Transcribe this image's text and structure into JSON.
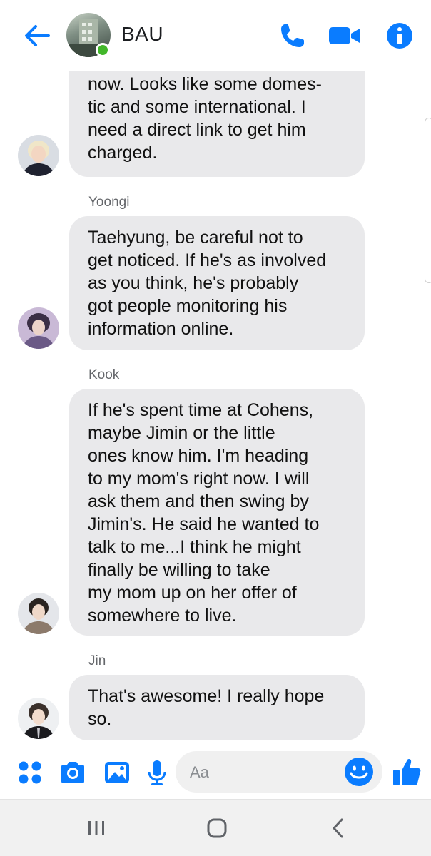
{
  "header": {
    "title": "BAU",
    "online": true,
    "icons": [
      "back-arrow-icon",
      "phone-icon",
      "video-icon",
      "info-icon"
    ],
    "accent_color": "#0a7cff"
  },
  "messages": [
    {
      "sender": "",
      "text": "I'm tracking that down right\nnow. Looks like some domes-\ntic and some international. I\nneed a direct link to get him\ncharged.",
      "avatar": "avatar-blond"
    },
    {
      "sender": "Yoongi",
      "text": "Taehyung, be careful not to\nget noticed. If he's as involved\nas you think, he's probably\ngot people monitoring his\ninformation online.",
      "avatar": "avatar-yoongi"
    },
    {
      "sender": "Kook",
      "text": "If he's spent time at Cohens,\nmaybe Jimin or the little\nones know him. I'm heading\nto my mom's right now. I will\nask them and then swing by\nJimin's. He said he wanted to\ntalk to me...I think he might\nfinally be willing to take\nmy mom up on her offer of\nsomewhere to live.",
      "avatar": "avatar-kook"
    },
    {
      "sender": "Jin",
      "text": "That's awesome! I really hope\nso.",
      "avatar": "avatar-jin"
    }
  ],
  "composer": {
    "placeholder": "Aa",
    "icons": [
      "apps-icon",
      "camera-icon",
      "gallery-icon",
      "mic-icon",
      "emoji-icon",
      "thumbs-up-icon"
    ]
  },
  "navbar": {
    "icons": [
      "recents-icon",
      "home-icon",
      "back-icon"
    ]
  }
}
